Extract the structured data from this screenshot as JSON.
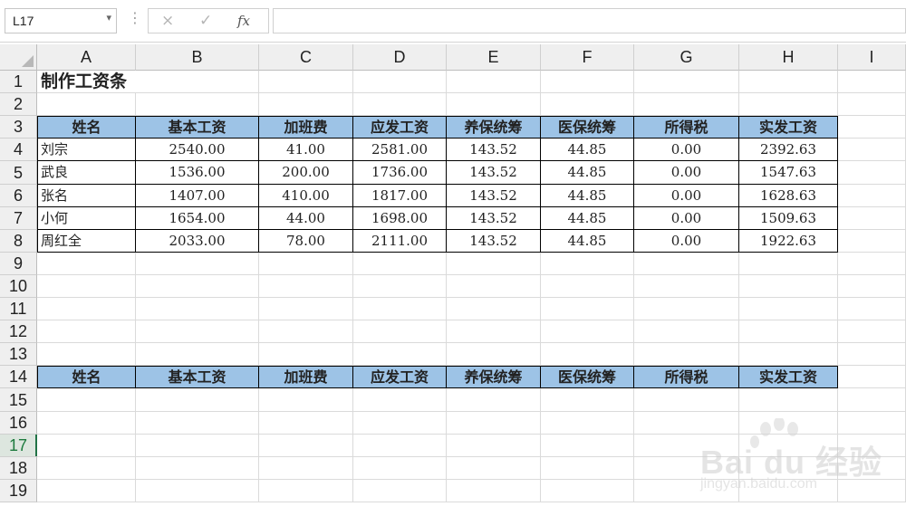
{
  "formula_bar": {
    "name_box": "L17",
    "cancel_icon": "×",
    "enter_icon": "✓",
    "function_icon": "fx",
    "formula": ""
  },
  "columns": [
    "A",
    "B",
    "C",
    "D",
    "E",
    "F",
    "G",
    "H",
    "I"
  ],
  "rows": [
    "1",
    "2",
    "3",
    "4",
    "5",
    "6",
    "7",
    "8",
    "9",
    "10",
    "11",
    "12",
    "13",
    "14",
    "15",
    "16",
    "17",
    "18",
    "19"
  ],
  "active_row": "17",
  "title": "制作工资条",
  "headers": [
    "姓名",
    "基本工资",
    "加班费",
    "应发工资",
    "养保统筹",
    "医保统筹",
    "所得税",
    "实发工资"
  ],
  "records": [
    [
      "刘宗",
      "2540.00",
      "41.00",
      "2581.00",
      "143.52",
      "44.85",
      "0.00",
      "2392.63"
    ],
    [
      "武良",
      "1536.00",
      "200.00",
      "1736.00",
      "143.52",
      "44.85",
      "0.00",
      "1547.63"
    ],
    [
      "张名",
      "1407.00",
      "410.00",
      "1817.00",
      "143.52",
      "44.85",
      "0.00",
      "1628.63"
    ],
    [
      "小何",
      "1654.00",
      "44.00",
      "1698.00",
      "143.52",
      "44.85",
      "0.00",
      "1509.63"
    ],
    [
      "周红全",
      "2033.00",
      "78.00",
      "2111.00",
      "143.52",
      "44.85",
      "0.00",
      "1922.63"
    ]
  ],
  "headers_copy": [
    "姓名",
    "基本工资",
    "加班费",
    "应发工资",
    "养保统筹",
    "医保统筹",
    "所得税",
    "实发工资"
  ],
  "watermark": {
    "main": "Bai du 经验",
    "sub": "jingyan.baidu.com"
  },
  "colors": {
    "header_fill": "#9dc3e6",
    "active_row_text": "#1d7a3e"
  }
}
